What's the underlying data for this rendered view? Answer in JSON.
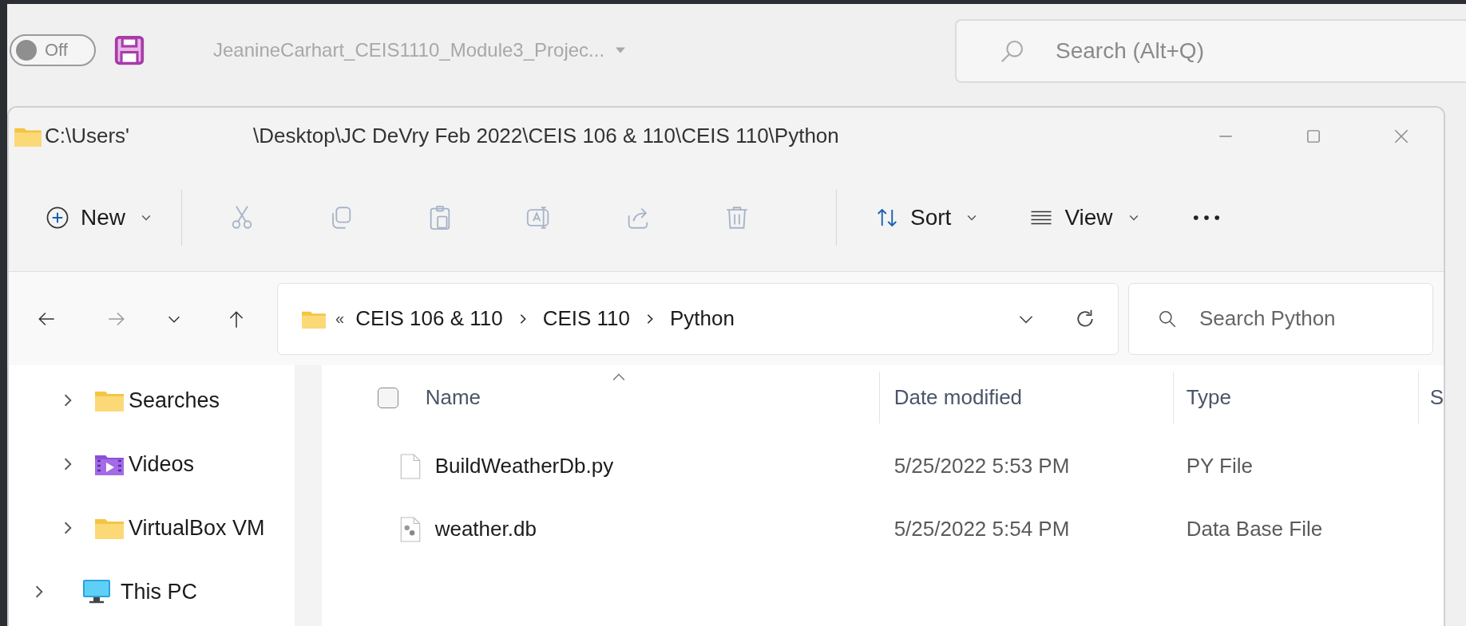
{
  "word_bar": {
    "autosave": {
      "label": "Off",
      "on": false
    },
    "document_title": "JeanineCarhart_CEIS1110_Module3_Projec...",
    "search": {
      "placeholder": "Search (Alt+Q)"
    }
  },
  "explorer": {
    "title_bar": {
      "path_start": "C:\\Users'",
      "path_end": "\\Desktop\\JC  DeVry Feb 2022\\CEIS 106 & 110\\CEIS 110\\Python"
    },
    "toolbar": {
      "new": "New",
      "actions": [
        {
          "kind": "cut",
          "disabled": true
        },
        {
          "kind": "copy",
          "disabled": true
        },
        {
          "kind": "paste",
          "disabled": true
        },
        {
          "kind": "rename",
          "disabled": true
        },
        {
          "kind": "share",
          "disabled": true
        },
        {
          "kind": "delete",
          "disabled": true
        }
      ],
      "sort": "Sort",
      "view": "View"
    },
    "address": {
      "overflow": "«",
      "crumbs": [
        "CEIS 106 & 110",
        "CEIS 110",
        "Python"
      ]
    },
    "search": {
      "placeholder": "Search Python"
    },
    "sidebar": {
      "items": [
        {
          "kind": "group",
          "children": [
            {
              "label": "Searches",
              "kind": "folder",
              "expanded": false
            },
            {
              "label": "Videos",
              "kind": "videos",
              "expanded": false
            },
            {
              "label": "VirtualBox VM",
              "kind": "folder",
              "expanded": false
            }
          ]
        },
        {
          "label": "This PC",
          "kind": "pc",
          "expanded": false
        }
      ]
    },
    "columns": [
      {
        "label": "Name",
        "sorted": true
      },
      {
        "label": "Date modified",
        "sorted": false
      },
      {
        "label": "Type",
        "sorted": false
      },
      {
        "label": "S",
        "sorted": false
      }
    ],
    "select_all": {
      "checked": false
    },
    "files": [
      {
        "name": "BuildWeatherDb.py",
        "kind": "py",
        "date": "5/25/2022 5:53 PM",
        "type": "PY File"
      },
      {
        "name": "weather.db",
        "kind": "db",
        "date": "5/25/2022 5:54 PM",
        "type": "Data Base File"
      }
    ]
  }
}
